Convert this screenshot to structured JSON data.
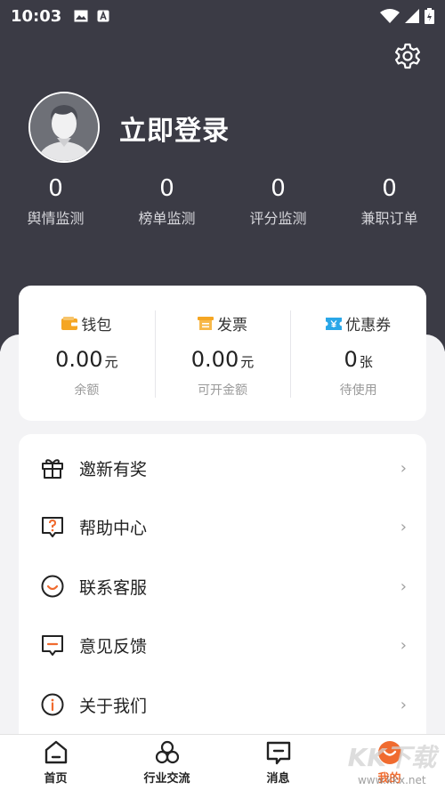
{
  "status_bar": {
    "time": "10:03"
  },
  "profile": {
    "login_text": "立即登录"
  },
  "stats": [
    {
      "value": "0",
      "label": "舆情监测"
    },
    {
      "value": "0",
      "label": "榜单监测"
    },
    {
      "value": "0",
      "label": "评分监测"
    },
    {
      "value": "0",
      "label": "兼职订单"
    }
  ],
  "wallet": [
    {
      "title": "钱包",
      "icon": "wallet-icon",
      "value": "0.00",
      "unit": "元",
      "sub": "余额"
    },
    {
      "title": "发票",
      "icon": "invoice-icon",
      "value": "0.00",
      "unit": "元",
      "sub": "可开金额"
    },
    {
      "title": "优惠券",
      "icon": "coupon-icon",
      "value": "0",
      "unit": "张",
      "sub": "待使用"
    }
  ],
  "menu": [
    {
      "label": "邀新有奖",
      "icon": "gift-icon"
    },
    {
      "label": "帮助中心",
      "icon": "help-icon"
    },
    {
      "label": "联系客服",
      "icon": "customer-service-icon"
    },
    {
      "label": "意见反馈",
      "icon": "feedback-icon"
    },
    {
      "label": "关于我们",
      "icon": "info-icon"
    }
  ],
  "tabs": [
    {
      "label": "首页",
      "icon": "home-icon"
    },
    {
      "label": "行业交流",
      "icon": "community-icon"
    },
    {
      "label": "消息",
      "icon": "message-icon"
    },
    {
      "label": "我的",
      "icon": "profile-icon",
      "active": true
    }
  ],
  "watermark": {
    "logo": "KK下载",
    "url": "www.kkx.net"
  },
  "colors": {
    "header_bg": "#3b3b45",
    "accent": "#f06b2f",
    "wallet_icon": "#f5a623",
    "coupon_icon": "#2aa7e8"
  }
}
